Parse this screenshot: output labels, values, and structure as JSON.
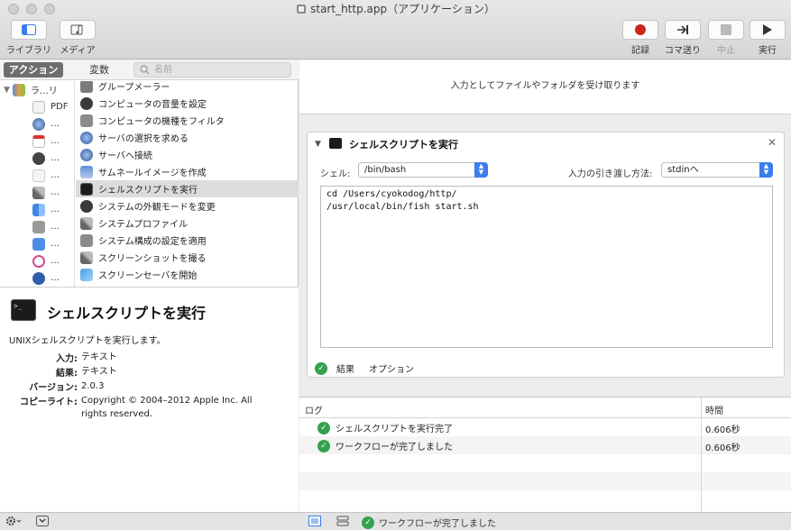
{
  "window": {
    "title": "start_http.app（アプリケーション）"
  },
  "toolbar": {
    "library_label": "ライブラリ",
    "media_label": "メディア",
    "record_label": "記録",
    "step_label": "コマ送り",
    "stop_label": "中止",
    "run_label": "実行"
  },
  "left": {
    "tab_actions": "アクション",
    "tab_variables": "変数",
    "search_placeholder": "名前",
    "library_items": [
      {
        "label": "ラ…リ",
        "icon": "library-books-icon"
      },
      {
        "label": "PDF",
        "icon": "pdf-icon"
      },
      {
        "label": "…",
        "icon": "globe-icon"
      },
      {
        "label": "…",
        "icon": "calendar-icon"
      },
      {
        "label": "…",
        "icon": "terminal-icon"
      },
      {
        "label": "…",
        "icon": "text-icon"
      },
      {
        "label": "…",
        "icon": "tools-icon"
      },
      {
        "label": "…",
        "icon": "finder-icon"
      },
      {
        "label": "…",
        "icon": "font-icon"
      },
      {
        "label": "…",
        "icon": "presentation-icon"
      },
      {
        "label": "…",
        "icon": "music-icon"
      },
      {
        "label": "…",
        "icon": "quicktime-icon"
      }
    ],
    "actions": [
      {
        "label": "グループメーラー",
        "icon": "mail-icon"
      },
      {
        "label": "コンピュータの音量を設定",
        "icon": "speaker-icon"
      },
      {
        "label": "コンピュータの機種をフィルタ",
        "icon": "filter-icon"
      },
      {
        "label": "サーバの選択を求める",
        "icon": "globe-icon"
      },
      {
        "label": "サーバへ接続",
        "icon": "globe-icon"
      },
      {
        "label": "サムネールイメージを作成",
        "icon": "image-icon"
      },
      {
        "label": "シェルスクリプトを実行",
        "icon": "terminal-icon",
        "selected": true
      },
      {
        "label": "システムの外観モードを変更",
        "icon": "appearance-icon"
      },
      {
        "label": "システムプロファイル",
        "icon": "tools-icon"
      },
      {
        "label": "システム構成の設定を適用",
        "icon": "filter-icon"
      },
      {
        "label": "スクリーンショットを撮る",
        "icon": "tools-icon"
      },
      {
        "label": "スクリーンセーバを開始",
        "icon": "screensaver-icon"
      }
    ],
    "description": {
      "title": "シェルスクリプトを実行",
      "text": "UNIXシェルスクリプトを実行します。",
      "input_key": "入力:",
      "input_value": "テキスト",
      "result_key": "結果:",
      "result_value": "テキスト",
      "version_key": "バージョン:",
      "version_value": "2.0.3",
      "copyright_key": "コピーライト:",
      "copyright_value": "Copyright © 2004–2012 Apple Inc.  All rights reserved."
    }
  },
  "workflow": {
    "input_note": "入力としてファイルやフォルダを受け取ります",
    "action": {
      "title": "シェルスクリプトを実行",
      "shell_label": "シェル:",
      "shell_value": "/bin/bash",
      "pass_label": "入力の引き渡し方法:",
      "pass_value": "stdinへ",
      "script": "cd /Users/cyokodog/http/\n/usr/local/bin/fish start.sh",
      "results_label": "結果",
      "options_label": "オプション"
    }
  },
  "log": {
    "col_log": "ログ",
    "col_time": "時間",
    "rows": [
      {
        "message": "シェルスクリプトを実行完了",
        "time": "0.606秒"
      },
      {
        "message": "ワークフローが完了しました",
        "time": "0.606秒"
      }
    ]
  },
  "statusbar": {
    "message": "ワークフローが完了しました"
  }
}
